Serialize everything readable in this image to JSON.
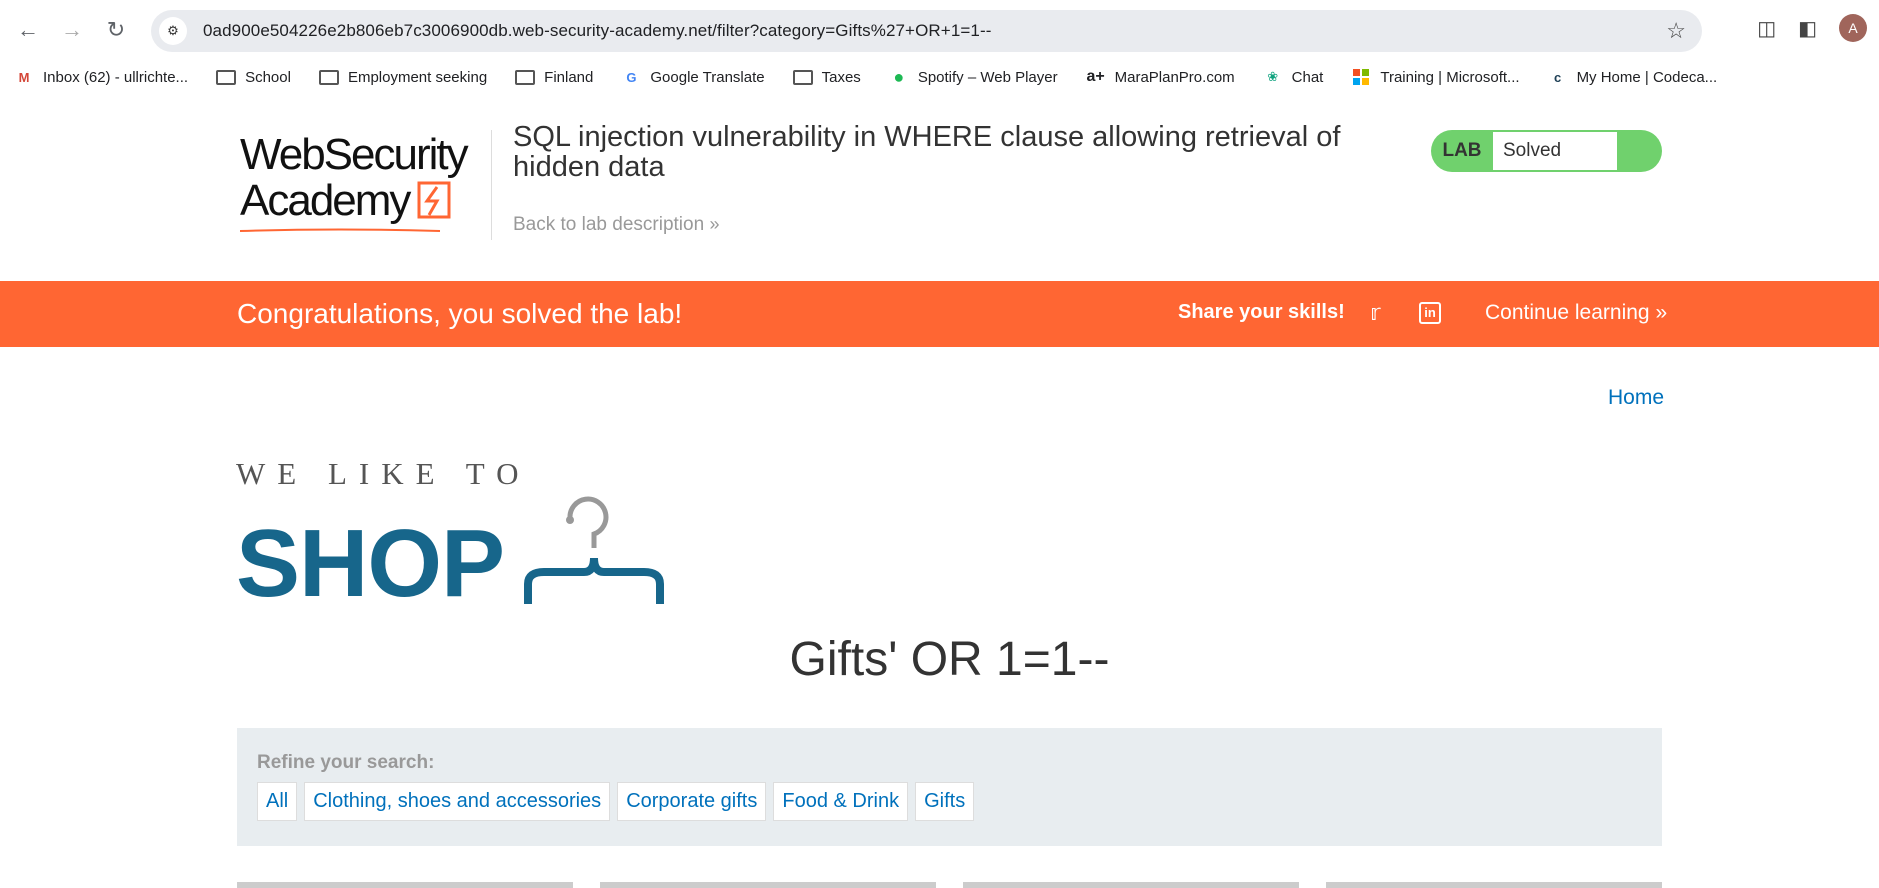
{
  "browser": {
    "url": "0ad900e504226e2b806eb7c3006900db.web-security-academy.net/filter?category=Gifts%27+OR+1=1--",
    "avatar_letter": "A",
    "bookmarks": [
      {
        "label": "Inbox (62) - ullrichte...",
        "icon": "gmail-icon"
      },
      {
        "label": "School",
        "icon": "folder-icon"
      },
      {
        "label": "Employment seeking",
        "icon": "folder-icon"
      },
      {
        "label": "Finland",
        "icon": "folder-icon"
      },
      {
        "label": "Google Translate",
        "icon": "translate-icon"
      },
      {
        "label": "Taxes",
        "icon": "folder-icon"
      },
      {
        "label": "Spotify – Web Player",
        "icon": "spotify-icon"
      },
      {
        "label": "MaraPlanPro.com",
        "icon": "a-plus-icon"
      },
      {
        "label": "Chat",
        "icon": "chat-icon"
      },
      {
        "label": "Training | Microsoft...",
        "icon": "microsoft-icon"
      },
      {
        "label": "My Home | Codeca...",
        "icon": "codecademy-icon"
      }
    ]
  },
  "lab": {
    "logo_line1": "WebSecurity",
    "logo_line2": "Academy",
    "title": "SQL injection vulnerability in WHERE clause allowing retrieval of hidden data",
    "back_link": "Back to lab description",
    "status_label": "LAB",
    "status_value": "Solved",
    "accent": "#70d16d"
  },
  "banner": {
    "message": "Congratulations, you solved the lab!",
    "share": "Share your skills!",
    "continue": "Continue learning",
    "color": "#ff6633"
  },
  "shop": {
    "home": "Home",
    "tagline": "WE LIKE TO",
    "brand": "SHOP",
    "brand_color": "#17668b",
    "category_title": "Gifts' OR 1=1--",
    "refine_label": "Refine your search:",
    "filters": [
      "All",
      "Clothing, shoes and accessories",
      "Corporate gifts",
      "Food & Drink",
      "Gifts"
    ]
  }
}
